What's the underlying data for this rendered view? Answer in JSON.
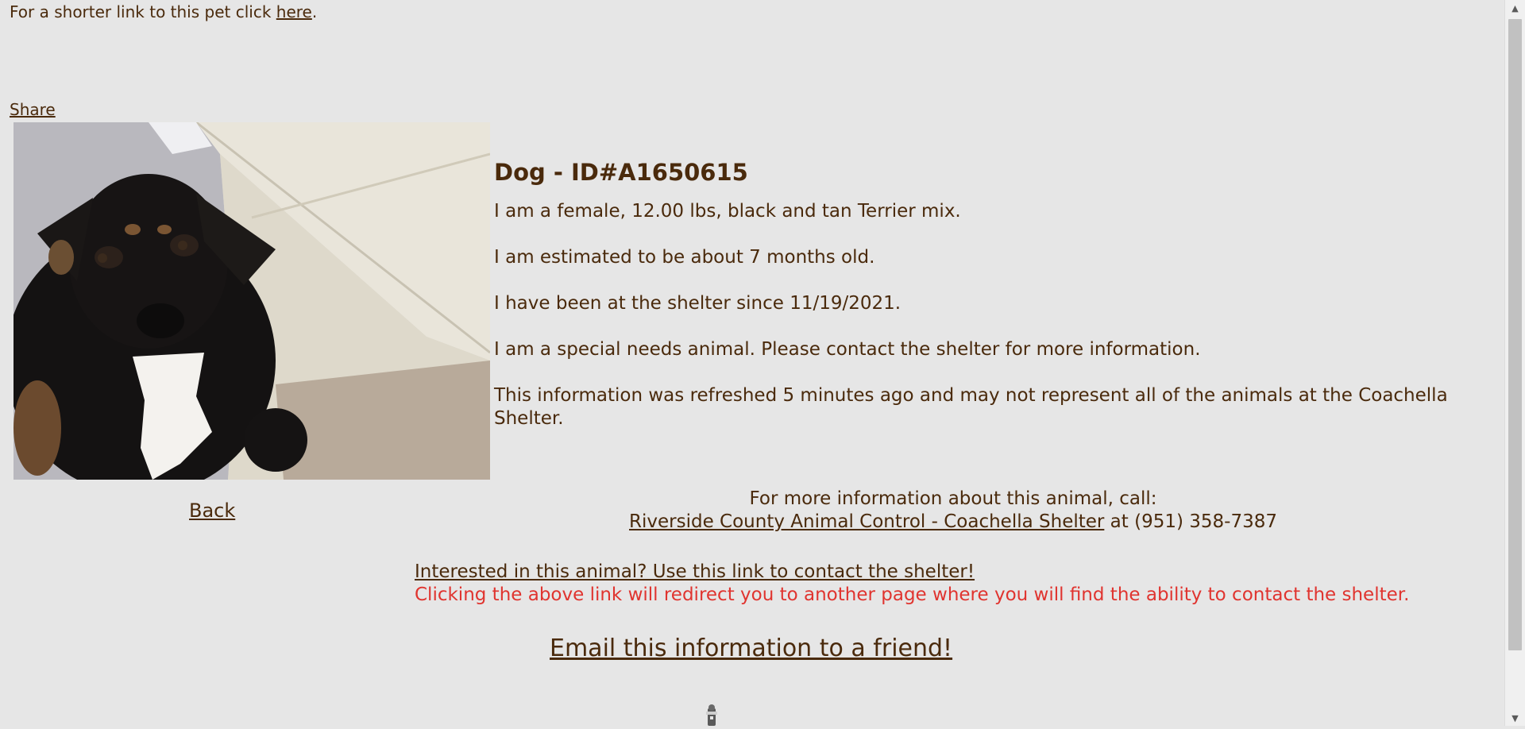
{
  "top": {
    "shorter_prefix": "For a shorter link to this pet click ",
    "shorter_link": "here",
    "shorter_suffix": ".",
    "share": "Share"
  },
  "animal": {
    "title": "Dog - ID#A1650615",
    "description": "I am a female, 12.00 lbs, black and tan Terrier mix.",
    "age": "I am estimated to be about 7 months old.",
    "since": "I have been at the shelter since 11/19/2021.",
    "special_needs": "I am a special needs animal. Please contact the shelter for more information.",
    "refreshed": "This information was refreshed 5 minutes ago and may not represent all of the animals at the Coachella Shelter."
  },
  "nav": {
    "back": "Back"
  },
  "contact": {
    "call_prompt": "For more information about this animal, call:",
    "shelter_link": "Riverside County Animal Control - Coachella Shelter",
    "phone_text": " at (951) 358-7387",
    "interested_link": "Interested in this animal? Use this link to contact the shelter!",
    "redirect_note": "Clicking the above link will redirect you to another page where you will find the ability to contact the shelter.",
    "email_link": "Email this information to a friend!"
  },
  "colors": {
    "background": "#e6e6e6",
    "text": "#4a2a0c",
    "warning": "#e0342f"
  }
}
